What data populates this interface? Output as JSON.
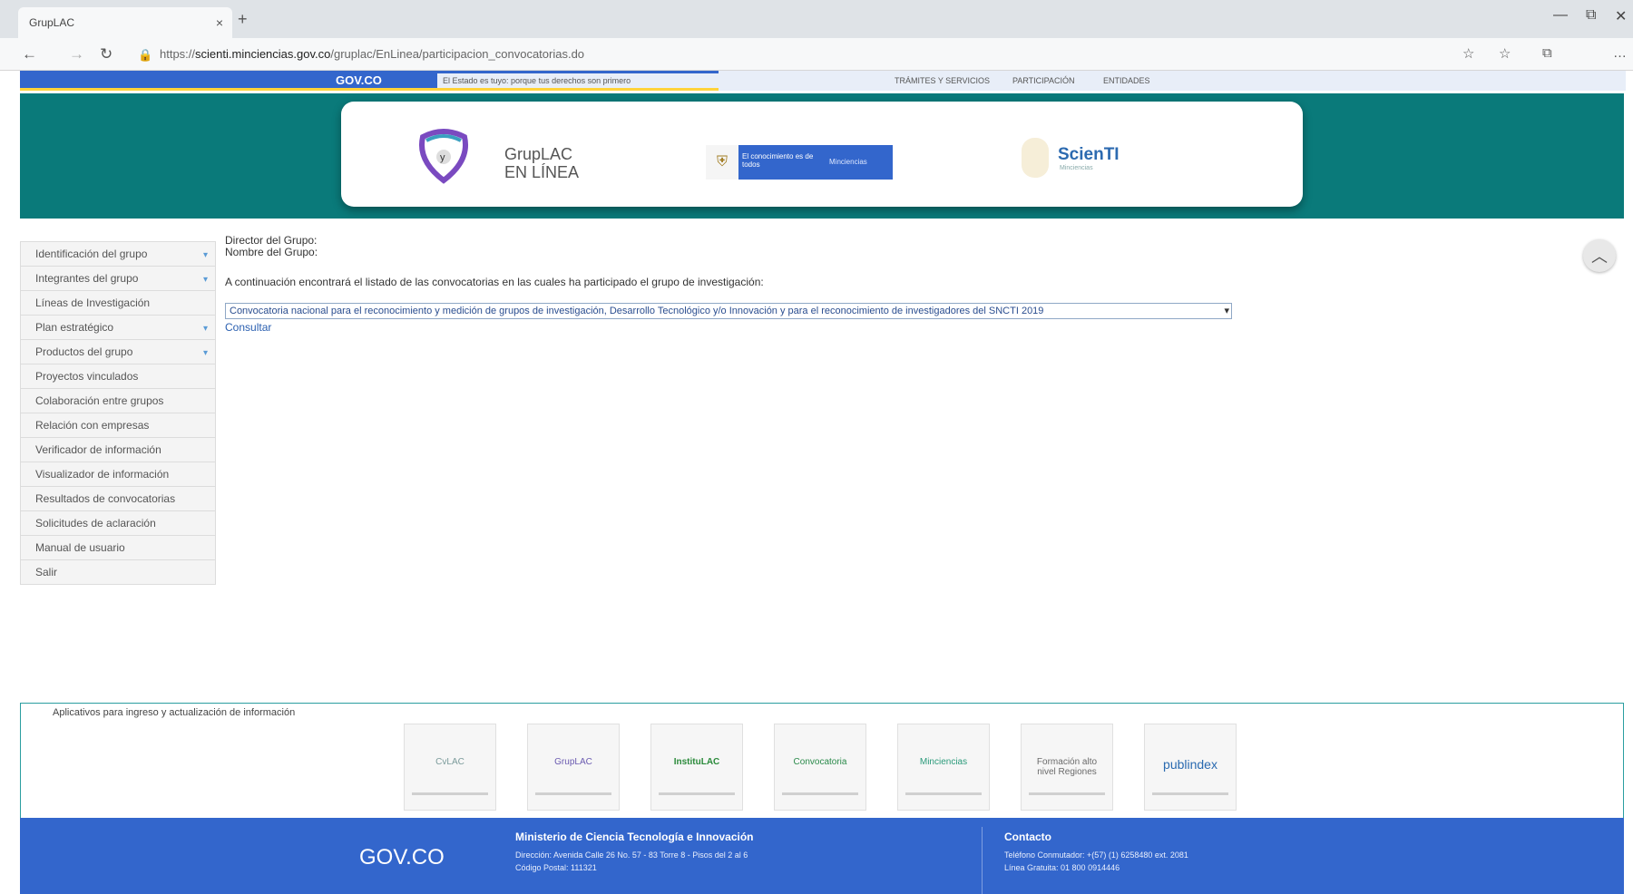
{
  "browser": {
    "tab_title": "GrupLAC",
    "tab_close": "×",
    "new_tab": "+",
    "url_prefix": "https://",
    "url_host": "scienti.minciencias.gov.co",
    "url_path": "/gruplac/EnLinea/participacion_convocatorias.do"
  },
  "govbar": {
    "logo": "GOV.CO",
    "slogan": "El Estado es tuyo: porque tus derechos son primero",
    "links": [
      "TRÁMITES Y SERVICIOS",
      "PARTICIPACIÓN",
      "ENTIDADES"
    ]
  },
  "banner": {
    "gruplac_line1": "GrupLAC",
    "gruplac_line2": "EN LÍNEA",
    "minc_text": "El conocimiento es de todos",
    "minc_sub": "Minciencias",
    "scienti": "ScienTI",
    "scienti_sub": "Minciencias"
  },
  "sidebar": {
    "items": [
      {
        "label": "Identificación del grupo",
        "chev": "▾"
      },
      {
        "label": "Integrantes del grupo",
        "chev": "▾"
      },
      {
        "label": "Líneas de Investigación",
        "chev": ""
      },
      {
        "label": "Plan estratégico",
        "chev": "▾"
      },
      {
        "label": "Productos del grupo",
        "chev": "▾"
      },
      {
        "label": "Proyectos vinculados",
        "chev": ""
      },
      {
        "label": "Colaboración entre grupos",
        "chev": ""
      },
      {
        "label": "Relación con empresas",
        "chev": ""
      },
      {
        "label": "Verificador de información",
        "chev": ""
      },
      {
        "label": "Visualizador de información",
        "chev": ""
      },
      {
        "label": "Resultados de convocatorias",
        "chev": ""
      },
      {
        "label": "Solicitudes de aclaración",
        "chev": ""
      },
      {
        "label": "Manual de usuario",
        "chev": ""
      },
      {
        "label": "Salir",
        "chev": ""
      }
    ]
  },
  "main": {
    "director_label": "Director del Grupo:",
    "name_label": "Nombre del Grupo:",
    "intro": "A continuación encontrará el listado de las convocatorias en las cuales ha participado el grupo de investigación:",
    "select_value": "Convocatoria nacional para el reconocimiento y medición de grupos de investigación, Desarrollo Tecnológico y/o Innovación y para el reconocimiento de investigadores del SNCTI 2019",
    "select_arrow": "▾",
    "consultar": "Consultar"
  },
  "apps": {
    "title": "Aplicativos para ingreso y actualización de información",
    "cards": [
      {
        "name": "CvLAC",
        "color": "#7a9a9a"
      },
      {
        "name": "GrupLAC",
        "color": "#6a5ab0"
      },
      {
        "name": "InstituLAC",
        "color": "#2a8a3a"
      },
      {
        "name": "Convocatoria",
        "color": "#2a8a4a"
      },
      {
        "name": "Minciencias",
        "color": "#2a9a7a"
      },
      {
        "name": "Formación alto nivel Regiones",
        "color": "#6a6a6a"
      },
      {
        "name": "publindex",
        "color": "#2a6ab0"
      }
    ]
  },
  "footer": {
    "logo": "GOV.CO",
    "ministry": "Ministerio de Ciencia Tecnología e Innovación",
    "address": "Dirección: Avenida Calle 26 No. 57 - 83 Torre 8 - Pisos del 2 al 6",
    "postal": "Código Postal: 111321",
    "contact_title": "Contacto",
    "phone": "Teléfono Conmutador: +(57) (1) 6258480 ext. 2081",
    "free_line": "Línea Gratuita: 01 800 0914446"
  }
}
